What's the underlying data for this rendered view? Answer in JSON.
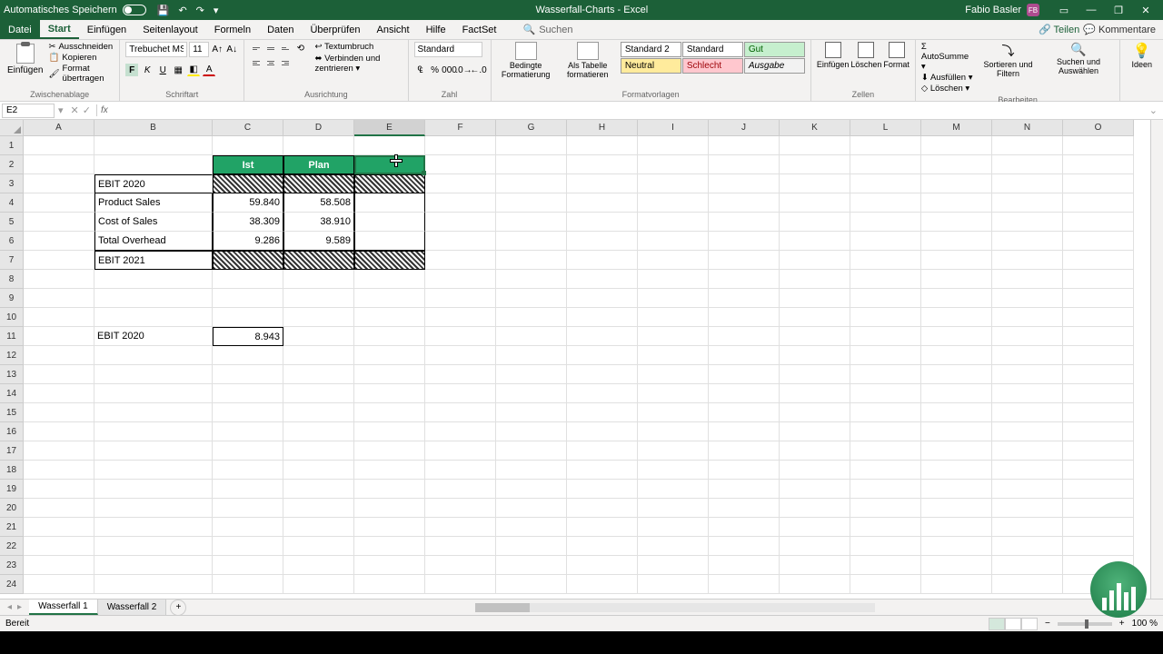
{
  "titlebar": {
    "autosave": "Automatisches Speichern",
    "title": "Wasserfall-Charts  -  Excel",
    "user": "Fabio Basler",
    "user_initials": "FB"
  },
  "menu": {
    "file": "Datei",
    "items": [
      "Start",
      "Einfügen",
      "Seitenlayout",
      "Formeln",
      "Daten",
      "Überprüfen",
      "Ansicht",
      "Hilfe",
      "FactSet"
    ],
    "search": "Suchen",
    "share": "Teilen",
    "comments": "Kommentare"
  },
  "ribbon": {
    "clipboard": {
      "title": "Zwischenablage",
      "paste": "Einfügen",
      "cut": "Ausschneiden",
      "copy": "Kopieren",
      "format_painter": "Format übertragen"
    },
    "font": {
      "title": "Schriftart",
      "family": "Trebuchet MS",
      "size": "11"
    },
    "alignment": {
      "title": "Ausrichtung",
      "wrap": "Textumbruch",
      "merge": "Verbinden und zentrieren"
    },
    "number": {
      "title": "Zahl",
      "format": "Standard"
    },
    "styles_group": {
      "title": "Formatvorlagen",
      "conditional": "Bedingte Formatierung",
      "as_table": "Als Tabelle formatieren",
      "styles": {
        "std2": "Standard 2",
        "std": "Standard",
        "gut": "Gut",
        "neutral": "Neutral",
        "schlecht": "Schlecht",
        "ausgabe": "Ausgabe"
      }
    },
    "cells": {
      "title": "Zellen",
      "insert": "Einfügen",
      "delete": "Löschen",
      "format": "Format"
    },
    "editing": {
      "title": "Bearbeiten",
      "autosum": "AutoSumme",
      "fill": "Ausfüllen",
      "clear": "Löschen",
      "sort": "Sortieren und Filtern",
      "find": "Suchen und Auswählen"
    },
    "ideas": "Ideen"
  },
  "formula_bar": {
    "name_box": "E2",
    "formula": ""
  },
  "columns": [
    "A",
    "B",
    "C",
    "D",
    "E",
    "F",
    "G",
    "H",
    "I",
    "J",
    "K",
    "L",
    "M",
    "N",
    "O"
  ],
  "rows_visible": 24,
  "table": {
    "headers": {
      "ist": "Ist",
      "plan": "Plan"
    },
    "rows": [
      {
        "label": "EBIT 2020",
        "ist": "",
        "plan": ""
      },
      {
        "label": "Product Sales",
        "ist": "59.840",
        "plan": "58.508"
      },
      {
        "label": "Cost of Sales",
        "ist": "38.309",
        "plan": "38.910"
      },
      {
        "label": "Total Overhead",
        "ist": "9.286",
        "plan": "9.589"
      },
      {
        "label": "EBIT 2021",
        "ist": "",
        "plan": ""
      }
    ],
    "summary": {
      "label": "EBIT 2020",
      "value": "8.943"
    }
  },
  "sheets": {
    "tabs": [
      "Wasserfall 1",
      "Wasserfall 2"
    ],
    "active": 0
  },
  "status": {
    "ready": "Bereit",
    "zoom": "100 %"
  },
  "selected_cell": "E2"
}
